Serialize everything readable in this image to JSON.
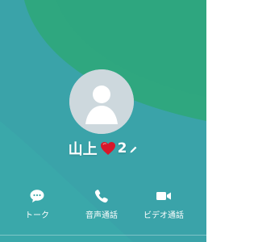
{
  "profile": {
    "name": "山上",
    "name_suffix": "2",
    "emoji": "heart-emoji"
  },
  "actions": [
    {
      "label": "トーク",
      "icon": "chat-bubble-icon"
    },
    {
      "label": "音声通話",
      "icon": "phone-icon"
    },
    {
      "label": "ビデオ通話",
      "icon": "video-camera-icon"
    }
  ],
  "colors": {
    "background": "#3ba8aa",
    "background_band": "#3fb0a9",
    "top_shape": "#2fa77f",
    "avatar_bg": "#cdd8dd",
    "avatar_silhouette": "#ffffff",
    "heart": "#d7172a",
    "text": "#ffffff"
  }
}
